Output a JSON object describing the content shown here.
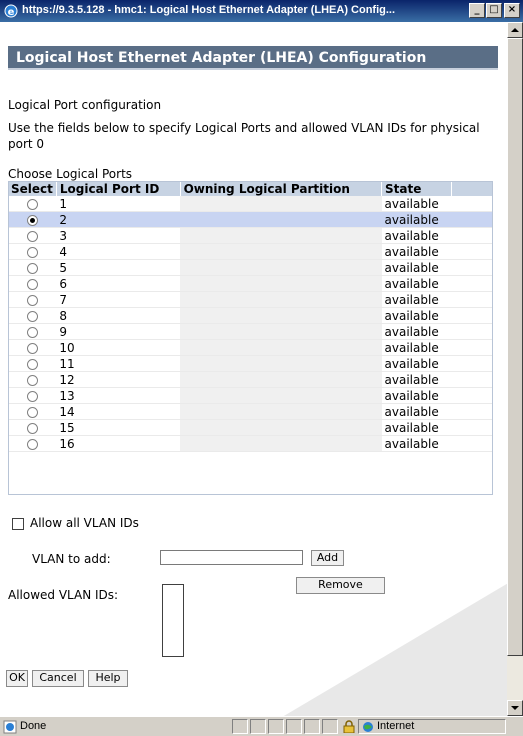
{
  "window": {
    "title": "https://9.3.5.128 - hmc1: Logical Host Ethernet Adapter (LHEA) Config...",
    "buttons": [
      "_",
      "□",
      "×"
    ]
  },
  "page": {
    "header": "Logical Host Ethernet Adapter (LHEA) Configuration",
    "section_title": "Logical Port configuration",
    "instructions": "Use the fields below to specify Logical Ports and allowed VLAN IDs for physical port 0",
    "choose_label": "Choose Logical Ports"
  },
  "table": {
    "headers": [
      "Select",
      "Logical Port ID",
      "Owning Logical Partition",
      "State"
    ],
    "selected_id": "2",
    "rows": [
      {
        "id": "1",
        "owner": "",
        "state": "available"
      },
      {
        "id": "2",
        "owner": "",
        "state": "available"
      },
      {
        "id": "3",
        "owner": "",
        "state": "available"
      },
      {
        "id": "4",
        "owner": "",
        "state": "available"
      },
      {
        "id": "5",
        "owner": "",
        "state": "available"
      },
      {
        "id": "6",
        "owner": "",
        "state": "available"
      },
      {
        "id": "7",
        "owner": "",
        "state": "available"
      },
      {
        "id": "8",
        "owner": "",
        "state": "available"
      },
      {
        "id": "9",
        "owner": "",
        "state": "available"
      },
      {
        "id": "10",
        "owner": "",
        "state": "available"
      },
      {
        "id": "11",
        "owner": "",
        "state": "available"
      },
      {
        "id": "12",
        "owner": "",
        "state": "available"
      },
      {
        "id": "13",
        "owner": "",
        "state": "available"
      },
      {
        "id": "14",
        "owner": "",
        "state": "available"
      },
      {
        "id": "15",
        "owner": "",
        "state": "available"
      },
      {
        "id": "16",
        "owner": "",
        "state": "available"
      }
    ]
  },
  "vlan": {
    "allow_all_label": "Allow all VLAN IDs",
    "allow_all_checked": false,
    "add_label": "VLAN to add:",
    "add_value": "",
    "add_button": "Add",
    "remove_button": "Remove",
    "allowed_label": "Allowed VLAN IDs:"
  },
  "footer_buttons": {
    "ok": "OK",
    "cancel": "Cancel",
    "help": "Help"
  },
  "status": {
    "text": "Done",
    "zone": "Internet"
  },
  "colors": {
    "header_bg": "#5a6e86",
    "table_header_bg": "#c7d3e3",
    "selected_row": "#c8d4f2"
  }
}
